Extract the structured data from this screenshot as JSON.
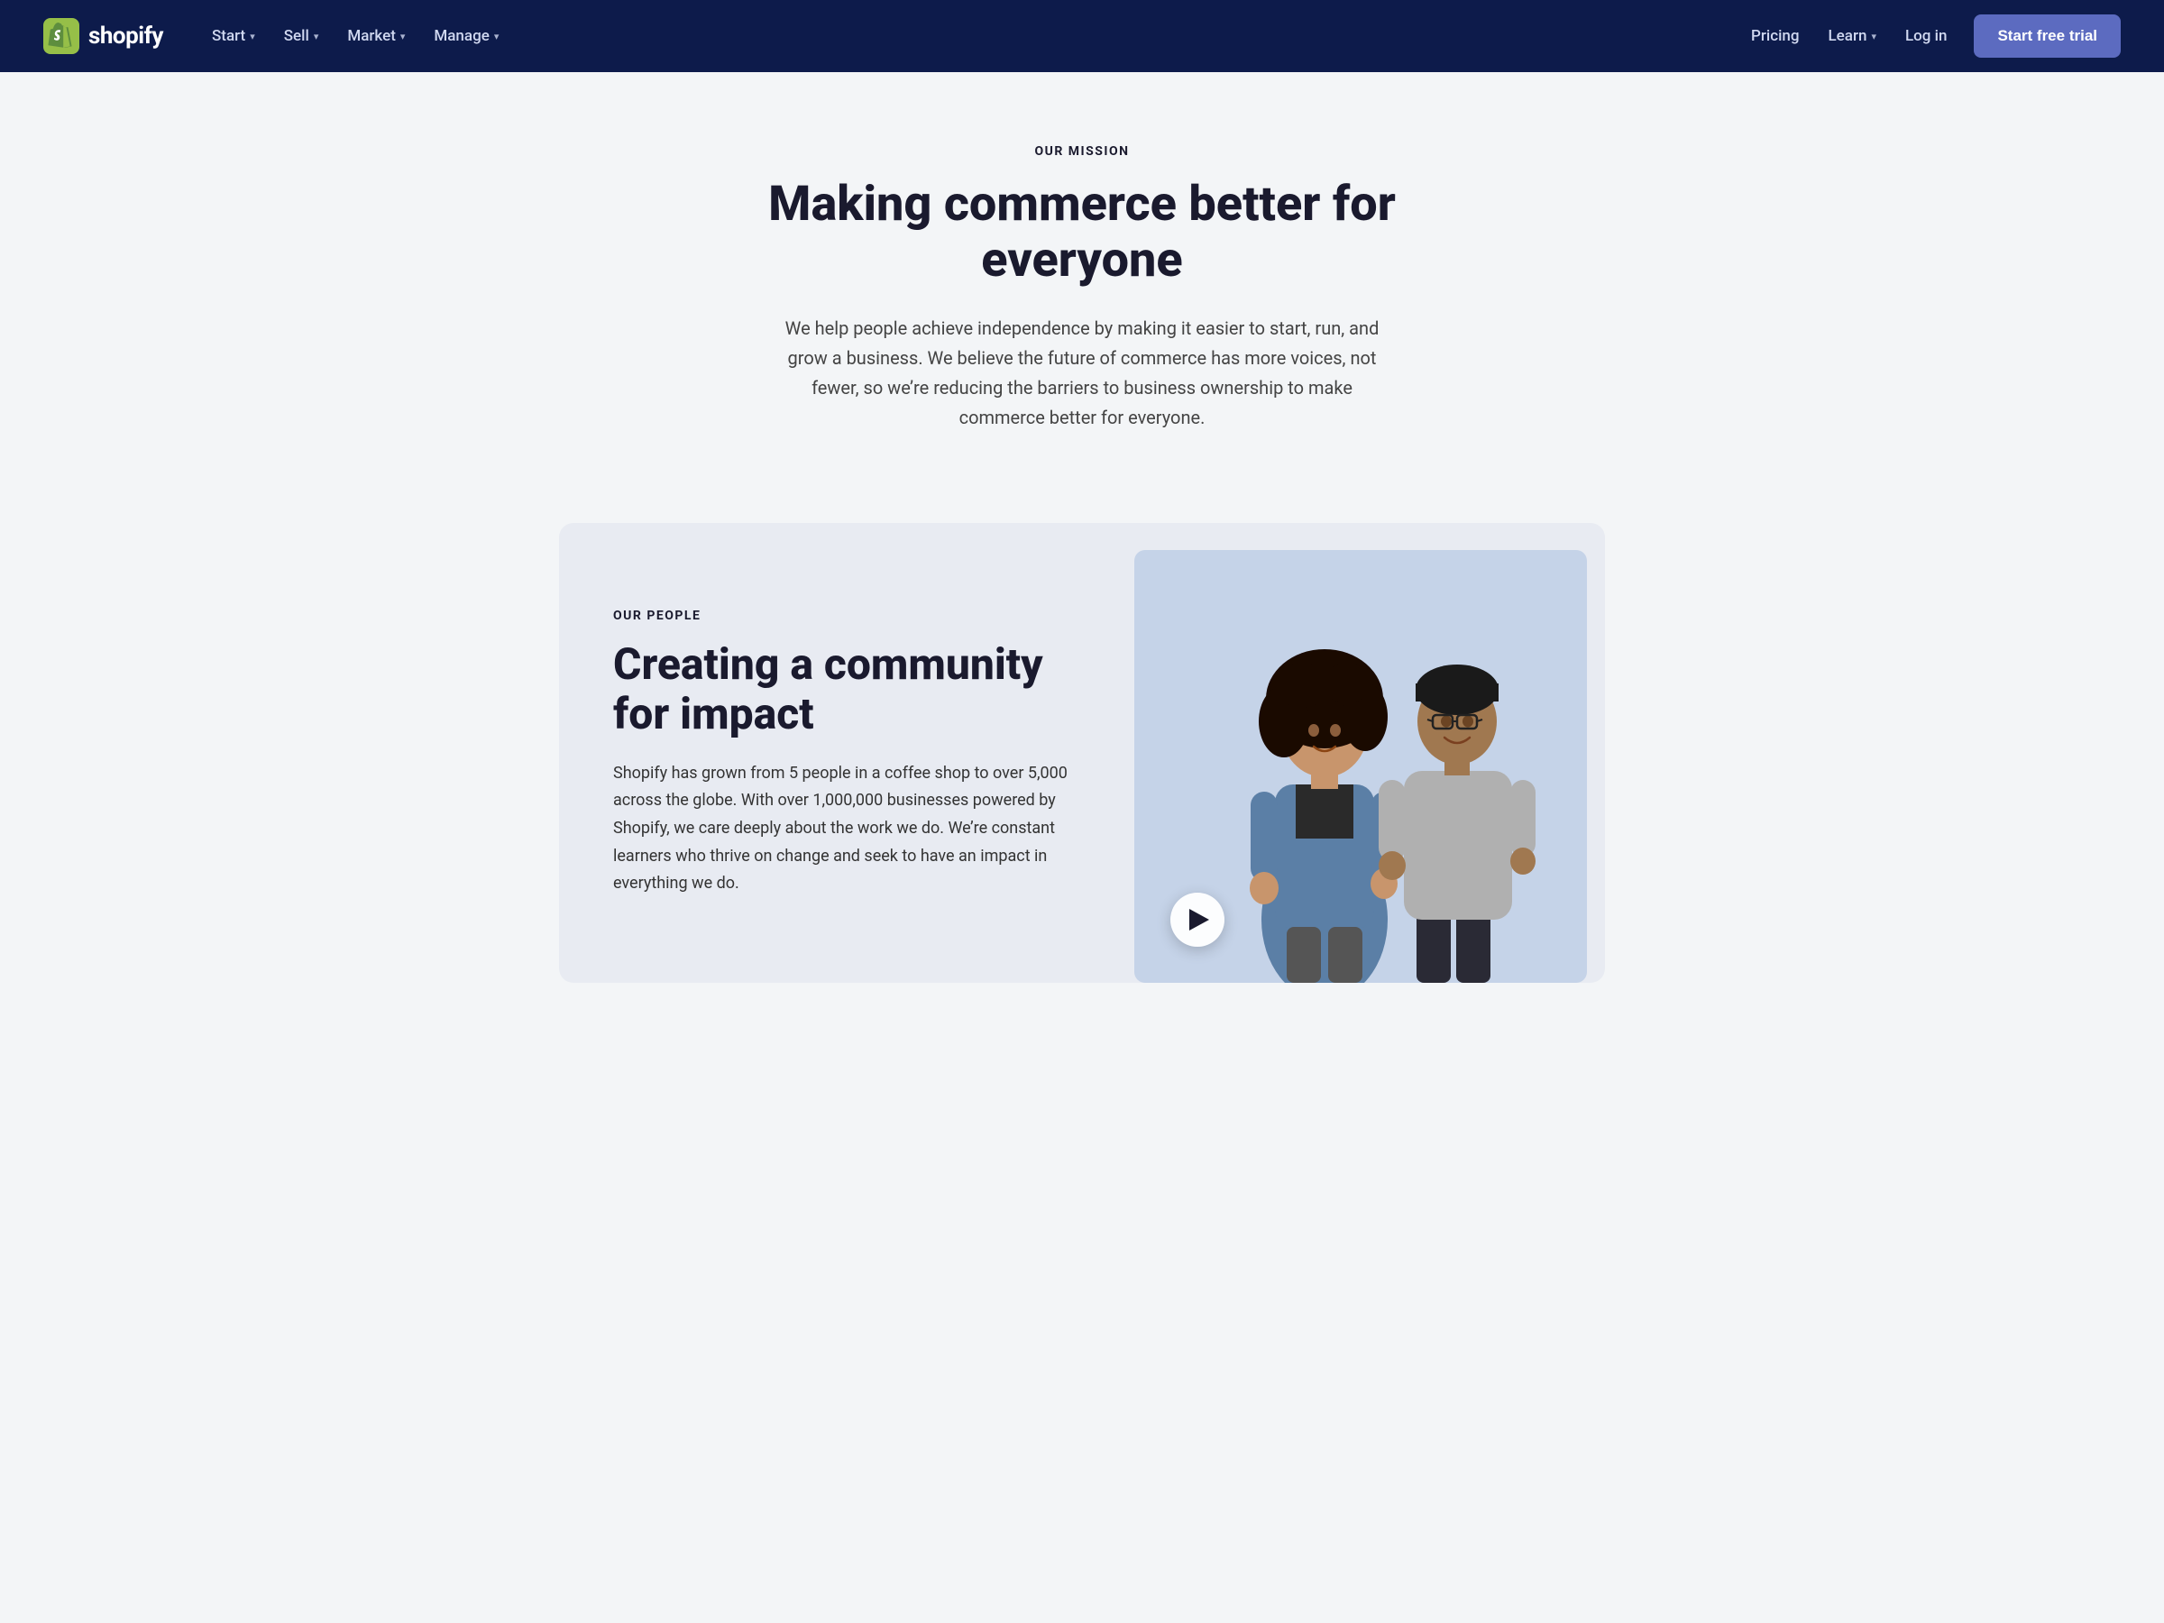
{
  "nav": {
    "logo_text": "shopify",
    "primary_links": [
      {
        "label": "Start",
        "has_chevron": true
      },
      {
        "label": "Sell",
        "has_chevron": true
      },
      {
        "label": "Market",
        "has_chevron": true
      },
      {
        "label": "Manage",
        "has_chevron": true
      }
    ],
    "secondary_links": [
      {
        "label": "Pricing",
        "has_chevron": false
      },
      {
        "label": "Learn",
        "has_chevron": true
      },
      {
        "label": "Log in",
        "has_chevron": false
      }
    ],
    "cta_label": "Start free trial"
  },
  "hero": {
    "label": "OUR MISSION",
    "title": "Making commerce better for everyone",
    "subtitle": "We help people achieve independence by making it easier to start, run, and grow a business. We believe the future of commerce has more voices, not fewer, so we’re reducing the barriers to business ownership to make commerce better for everyone."
  },
  "people": {
    "label": "OUR PEOPLE",
    "title": "Creating a community for impact",
    "body": "Shopify has grown from 5 people in a coffee shop to over 5,000 across the globe. With over 1,000,000 businesses powered by Shopify, we care deeply about the work we do. We’re constant learners who thrive on change and seek to have an impact in everything we do."
  },
  "colors": {
    "nav_bg": "#0d1b4b",
    "page_bg": "#f3f5f7",
    "card_bg": "#e8ebf2",
    "photo_bg": "#c5d3e8",
    "cta_btn": "#5c6bc0",
    "text_dark": "#1a1a2e",
    "text_body": "#333333"
  }
}
